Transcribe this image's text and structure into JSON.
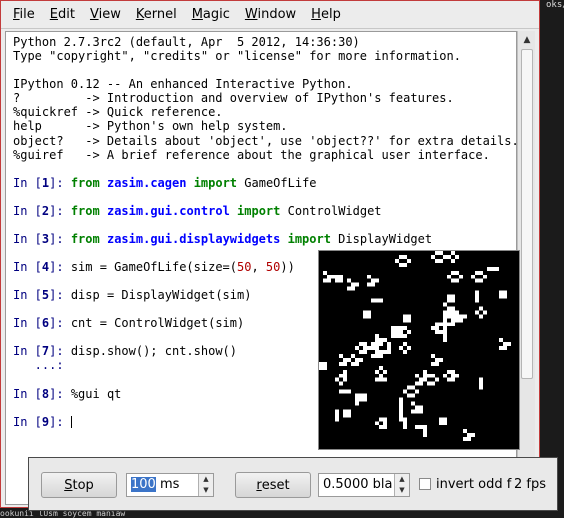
{
  "background": {
    "top_right_text": "oks/",
    "bottom_text": "ookunii lUsm soycem maniaw"
  },
  "menu": {
    "items": [
      {
        "pre": "",
        "ul": "F",
        "post": "ile"
      },
      {
        "pre": "",
        "ul": "E",
        "post": "dit"
      },
      {
        "pre": "",
        "ul": "V",
        "post": "iew"
      },
      {
        "pre": "",
        "ul": "K",
        "post": "ernel"
      },
      {
        "pre": "",
        "ul": "M",
        "post": "agic"
      },
      {
        "pre": "",
        "ul": "W",
        "post": "indow"
      },
      {
        "pre": "",
        "ul": "H",
        "post": "elp"
      }
    ]
  },
  "banner": [
    "Python 2.7.3rc2 (default, Apr  5 2012, 14:36:30)",
    "Type \"copyright\", \"credits\" or \"license\" for more information.",
    "",
    "IPython 0.12 -- An enhanced Interactive Python.",
    "?         -> Introduction and overview of IPython's features.",
    "%quickref -> Quick reference.",
    "help      -> Python's own help system.",
    "object?   -> Details about 'object', use 'object??' for extra details.",
    "%guiref   -> A brief reference about the graphical user interface."
  ],
  "cells": [
    {
      "n": "1",
      "parts": [
        {
          "t": "kw",
          "v": "from"
        },
        {
          "t": "sp",
          "v": " "
        },
        {
          "t": "mod",
          "v": "zasim.cagen"
        },
        {
          "t": "sp",
          "v": " "
        },
        {
          "t": "kw",
          "v": "import"
        },
        {
          "t": "txt",
          "v": " GameOfLife"
        }
      ]
    },
    {
      "n": "2",
      "parts": [
        {
          "t": "kw",
          "v": "from"
        },
        {
          "t": "sp",
          "v": " "
        },
        {
          "t": "mod",
          "v": "zasim.gui.control"
        },
        {
          "t": "sp",
          "v": " "
        },
        {
          "t": "kw",
          "v": "import"
        },
        {
          "t": "txt",
          "v": " ControlWidget"
        }
      ]
    },
    {
      "n": "3",
      "parts": [
        {
          "t": "kw",
          "v": "from"
        },
        {
          "t": "sp",
          "v": " "
        },
        {
          "t": "mod",
          "v": "zasim.gui.displaywidgets"
        },
        {
          "t": "sp",
          "v": " "
        },
        {
          "t": "kw",
          "v": "import"
        },
        {
          "t": "txt",
          "v": " DisplayWidget"
        }
      ]
    },
    {
      "n": "4",
      "parts": [
        {
          "t": "txt",
          "v": "sim = GameOfLife(size=("
        },
        {
          "t": "num",
          "v": "50"
        },
        {
          "t": "txt",
          "v": ", "
        },
        {
          "t": "num",
          "v": "50"
        },
        {
          "t": "txt",
          "v": "))"
        }
      ]
    },
    {
      "n": "5",
      "parts": [
        {
          "t": "txt",
          "v": "disp = DisplayWidget(sim)"
        }
      ]
    },
    {
      "n": "6",
      "parts": [
        {
          "t": "txt",
          "v": "cnt = ControlWidget(sim)"
        }
      ]
    },
    {
      "n": "7",
      "parts": [
        {
          "t": "txt",
          "v": "disp.show(); cnt.show()"
        }
      ],
      "continuation": "   ...:"
    },
    {
      "n": "8",
      "parts": [
        {
          "t": "txt",
          "v": "%gui qt"
        }
      ]
    },
    {
      "n": "9",
      "parts": [],
      "cursor": true
    }
  ],
  "prompt_prefix": "In [",
  "prompt_suffix": "]: ",
  "control": {
    "stop_label_ul": "S",
    "stop_label_rest": "top",
    "delay_value": "100",
    "delay_unit": " ms",
    "reset_label_ul": "r",
    "reset_label_rest": "eset",
    "probability_value": "0.5000 bla",
    "invert_label": "invert odd f",
    "invert_checked": false,
    "fps_label": "2 fps"
  },
  "colors": {
    "keyword": "#008000",
    "module": "#0000ff",
    "prompt": "#000080",
    "number": "#b00000",
    "alive_cell": "#ffffff",
    "dead_cell": "#000000"
  }
}
